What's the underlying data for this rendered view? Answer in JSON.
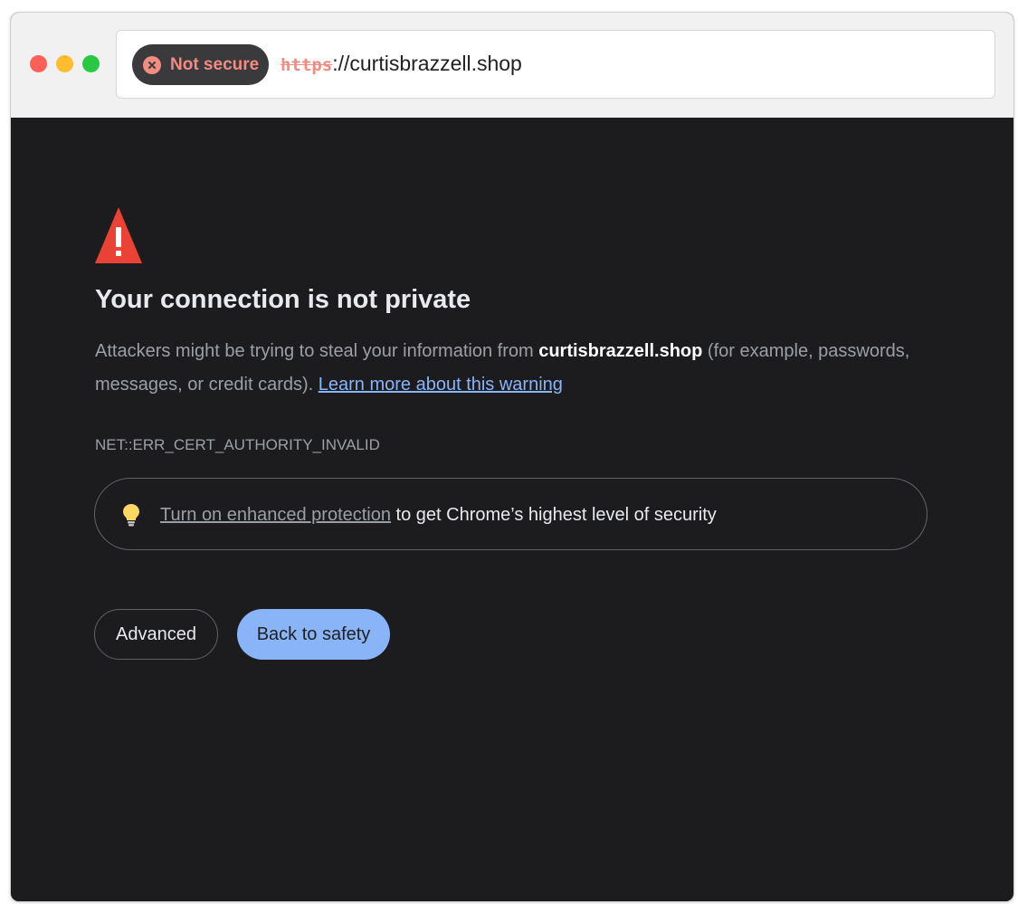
{
  "titlebar": {
    "traffic_lights": [
      "close",
      "minimize",
      "zoom"
    ]
  },
  "omnibox": {
    "security_chip_label": "Not secure",
    "security_chip_icon": "close-circle-icon",
    "url_scheme": "https",
    "url_rest": "://curtisbrazzell.shop"
  },
  "interstitial": {
    "icon": "warning-triangle-icon",
    "heading": "Your connection is not private",
    "body_prefix": "Attackers might be trying to steal your information from ",
    "body_host": "curtisbrazzell.shop",
    "body_suffix": " (for example, passwords, messages, or credit cards). ",
    "learn_more_link": "Learn more about this warning",
    "error_code": "NET::ERR_CERT_AUTHORITY_INVALID",
    "protection": {
      "icon": "lightbulb-icon",
      "link_text": "Turn on enhanced protection",
      "suffix_text": " to get Chrome’s highest level of security"
    },
    "buttons": {
      "advanced_label": "Advanced",
      "back_label": "Back to safety"
    }
  },
  "colors": {
    "page_background": "#1c1c1f",
    "warning_red": "#ea4335",
    "link_blue": "#8ab4f8",
    "not_secure_red": "#f28b82",
    "primary_button": "#8ab4f8"
  }
}
